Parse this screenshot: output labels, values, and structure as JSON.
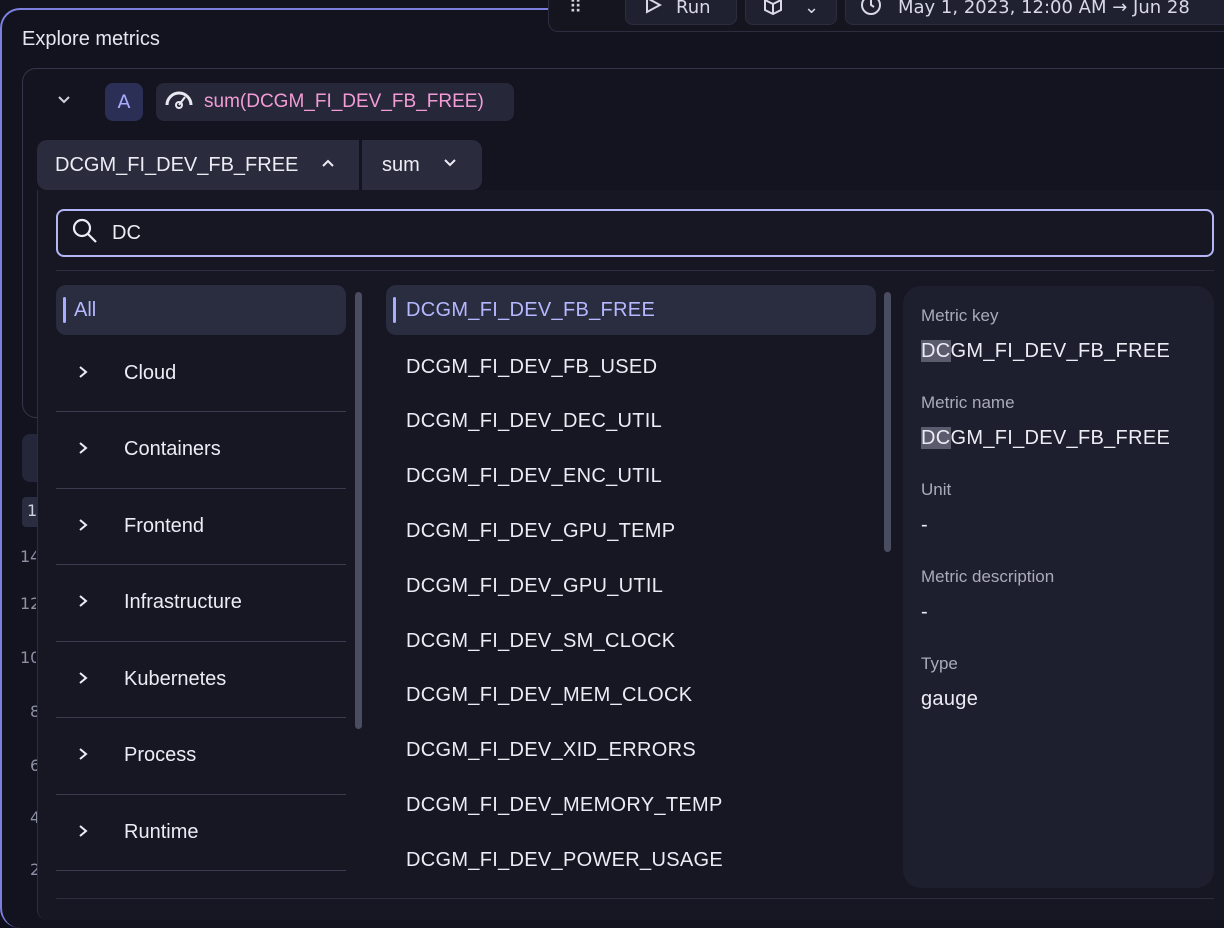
{
  "panel": {
    "title": "Explore metrics"
  },
  "toolbar": {
    "run_label": "Run",
    "timeframe": "May 1, 2023, 12:00 AM → Jun 28"
  },
  "query": {
    "letter": "A",
    "expression": "sum(DCGM_FI_DEV_FB_FREE)",
    "metric_select": "DCGM_FI_DEV_FB_FREE",
    "aggregation": "sum"
  },
  "underlying": {
    "badge": "1",
    "y_ticks": [
      "14",
      "12",
      "10",
      "8",
      "6",
      "4",
      "2"
    ]
  },
  "search": {
    "value": "DC"
  },
  "categories": {
    "all": "All",
    "items": [
      "Cloud",
      "Containers",
      "Frontend",
      "Infrastructure",
      "Kubernetes",
      "Process",
      "Runtime"
    ]
  },
  "metrics": {
    "items": [
      "DCGM_FI_DEV_FB_FREE",
      "DCGM_FI_DEV_FB_USED",
      "DCGM_FI_DEV_DEC_UTIL",
      "DCGM_FI_DEV_ENC_UTIL",
      "DCGM_FI_DEV_GPU_TEMP",
      "DCGM_FI_DEV_GPU_UTIL",
      "DCGM_FI_DEV_SM_CLOCK",
      "DCGM_FI_DEV_MEM_CLOCK",
      "DCGM_FI_DEV_XID_ERRORS",
      "DCGM_FI_DEV_MEMORY_TEMP",
      "DCGM_FI_DEV_POWER_USAGE"
    ]
  },
  "details": {
    "key_label": "Metric key",
    "key_match": "DC",
    "key_rest": "GM_FI_DEV_FB_FREE",
    "name_label": "Metric name",
    "name_match": "DC",
    "name_rest": "GM_FI_DEV_FB_FREE",
    "unit_label": "Unit",
    "unit_value": "-",
    "desc_label": "Metric description",
    "desc_value": "-",
    "type_label": "Type",
    "type_value": "gauge"
  },
  "colors": {
    "accent": "#a9adff",
    "expression_pink": "#f39bd6",
    "background": "#12131f"
  }
}
